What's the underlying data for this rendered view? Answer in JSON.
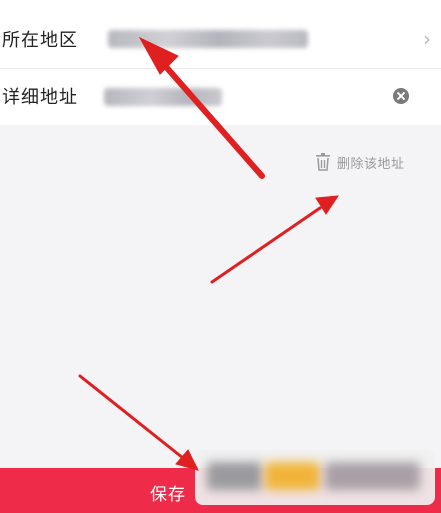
{
  "form": {
    "region_label": "所在地区",
    "detail_label": "详细地址"
  },
  "delete_label": "删除该地址",
  "save_label": "保存",
  "icons": {
    "chevron": "chevron-right-icon",
    "clear": "clear-circle-icon",
    "trash": "trash-icon"
  },
  "colors": {
    "accent": "#ee2c4a",
    "annotation_arrow": "#e02020"
  }
}
